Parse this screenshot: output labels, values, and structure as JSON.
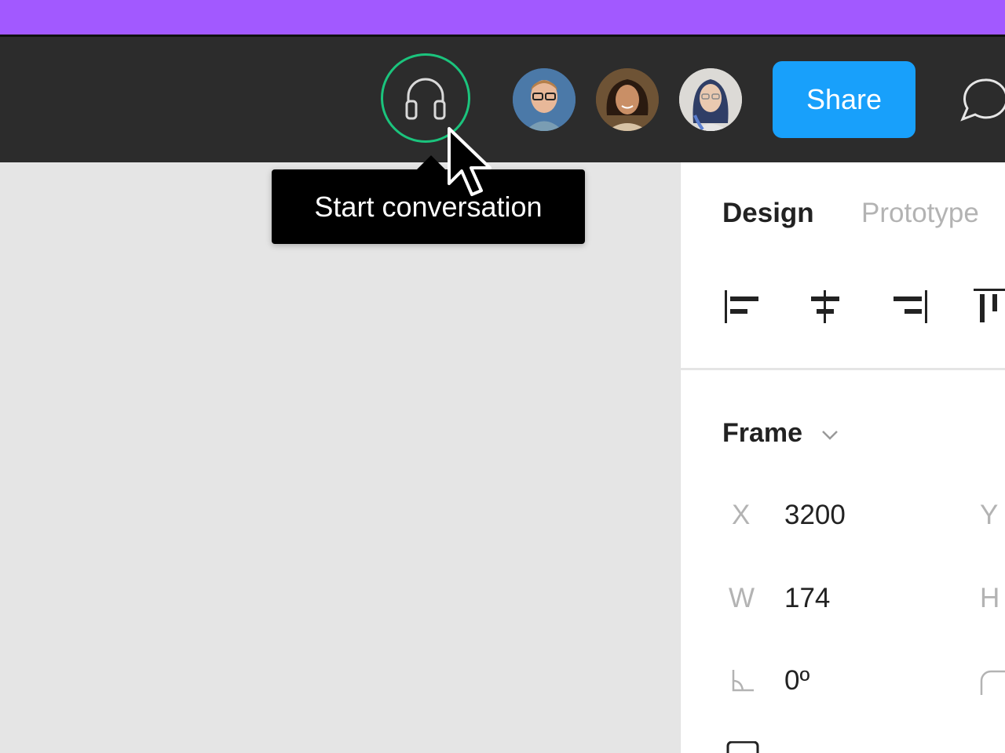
{
  "toolbar": {
    "audio_button_icon": "headphones-icon",
    "share_label": "Share",
    "comment_icon": "comment-bubble-icon",
    "accent_color": "#a259ff",
    "audio_active_color": "#1bc47d",
    "share_color": "#18a0fb"
  },
  "tooltip": {
    "text": "Start conversation"
  },
  "avatars": [
    {
      "icon": "avatar-user-1"
    },
    {
      "icon": "avatar-user-2"
    },
    {
      "icon": "avatar-user-3"
    }
  ],
  "panel": {
    "tabs": [
      {
        "label": "Design",
        "active": true
      },
      {
        "label": "Prototype",
        "active": false
      }
    ],
    "align_icons": [
      "align-left-icon",
      "align-horizontal-center-icon",
      "align-right-icon",
      "align-top-icon"
    ],
    "frame_label": "Frame",
    "props": {
      "x_label": "X",
      "x_value": "3200",
      "y_label": "Y",
      "w_label": "W",
      "w_value": "174",
      "h_label": "H",
      "rotation_value": "0º"
    }
  }
}
